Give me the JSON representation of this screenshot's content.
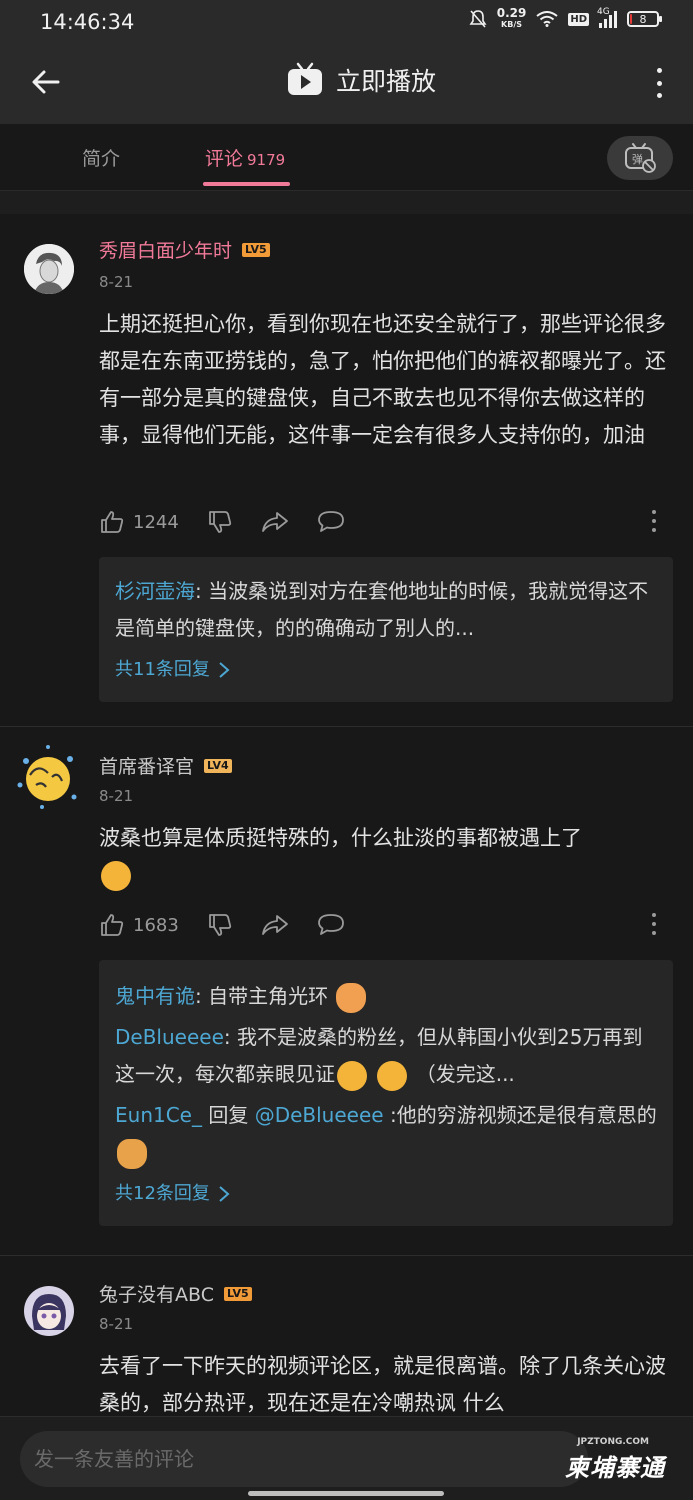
{
  "status_bar": {
    "time": "14:46:34",
    "net_speed": "0.29",
    "net_unit": "KB/S",
    "hd": "HD",
    "signal": "4G",
    "battery": "8",
    "battery_level": 0.08
  },
  "header": {
    "title": "立即播放"
  },
  "tabs": [
    {
      "label": "简介",
      "count": ""
    },
    {
      "label": "评论",
      "count": "9179"
    }
  ],
  "colors": {
    "accent": "#f17a99",
    "link": "#4da7d3",
    "background": "#181818"
  },
  "comments": [
    {
      "user": "秀眉白面少年时",
      "level": "LV5",
      "date": "8-21",
      "text": "上期还挺担心你，看到你现在也还安全就行了，那些评论很多都是在东南亚捞钱的，急了，怕你把他们的裤衩都曝光了。还有一部分是真的键盘侠，自己不敢去也见不得你去做这样的事，显得他们无能，这件事一定会有很多人支持你的，加油",
      "likes": "1244",
      "replies": [
        {
          "who": "杉河壶海",
          "sep": ": ",
          "text": "当波桑说到对方在套他地址的时候，我就觉得这不是简单的键盘侠，的的确确动了别人的..."
        }
      ],
      "more_replies": "共11条回复"
    },
    {
      "user": "首席番译官",
      "level": "LV4",
      "date": "8-21",
      "text": "波桑也算是体质挺特殊的，什么扯淡的事都被遇上了",
      "likes": "1683",
      "replies": [
        {
          "who": "鬼中有诡",
          "sep": ": ",
          "text": "自带主角光环"
        },
        {
          "who": "DeBlueeee",
          "sep": ": ",
          "text": "我不是波桑的粉丝，但从韩国小伙到25万再到这一次，每次都亲眼见证",
          "tail": "（发完这..."
        },
        {
          "who": "Eun1Ce_",
          "mid": " 回复 ",
          "target": "@DeBlueeee",
          "text": " :他的穷游视频还是很有意思的"
        }
      ],
      "more_replies": "共12条回复"
    },
    {
      "user": "兔子没有ABC",
      "level": "LV5",
      "date": "8-21",
      "text": "去看了一下昨天的视频评论区，就是很离谱。除了几条关心波桑的，部分热评，现在还是在冷嘲热讽 什么"
    }
  ],
  "input": {
    "placeholder": "发一条友善的评论"
  },
  "watermark": {
    "brand": "柬埔寨通",
    "url": "JPZTONG.COM"
  },
  "icons": [
    "bell-mute-icon",
    "wifi-icon",
    "signal-icon",
    "battery-icon",
    "back-arrow-icon",
    "tv-play-icon",
    "more-vertical-icon",
    "danmaku-off-icon",
    "thumb-up-icon",
    "thumb-down-icon",
    "share-icon",
    "reply-icon",
    "chevron-right-icon",
    "emoji-sticker-icon"
  ]
}
